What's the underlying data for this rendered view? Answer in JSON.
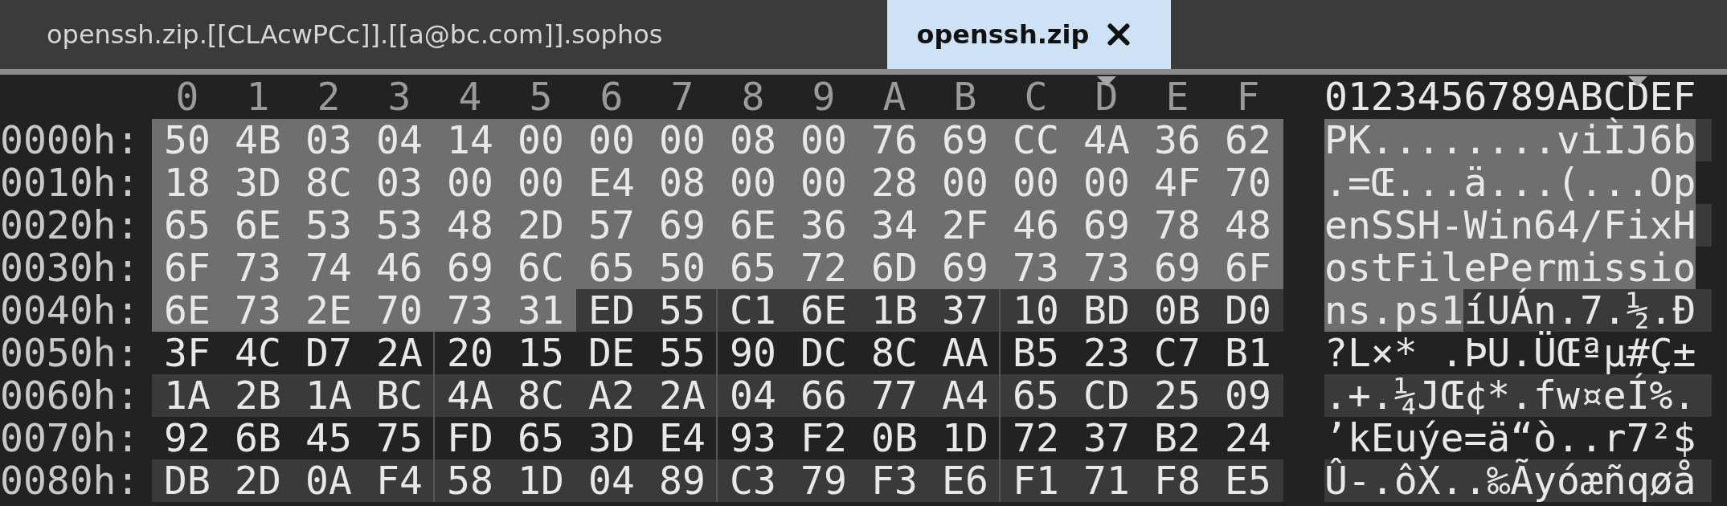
{
  "tabs": [
    {
      "label": "openssh.zip.[[CLAcwPCc]].[[a@bc.com]].sophos",
      "selected": false,
      "closable": false
    },
    {
      "label": "openssh.zip",
      "selected": true,
      "closable": true
    }
  ],
  "hex_view": {
    "columns": [
      {
        "label": "0",
        "marked": false
      },
      {
        "label": "1",
        "marked": false
      },
      {
        "label": "2",
        "marked": false
      },
      {
        "label": "3",
        "marked": false
      },
      {
        "label": "4",
        "marked": false
      },
      {
        "label": "5",
        "marked": false
      },
      {
        "label": "6",
        "marked": false
      },
      {
        "label": "7",
        "marked": false
      },
      {
        "label": "8",
        "marked": false
      },
      {
        "label": "9",
        "marked": false
      },
      {
        "label": "A",
        "marked": false
      },
      {
        "label": "B",
        "marked": false
      },
      {
        "label": "C",
        "marked": false
      },
      {
        "label": "D",
        "marked": true
      },
      {
        "label": "E",
        "marked": false
      },
      {
        "label": "F",
        "marked": false
      }
    ],
    "text_header": "0123456789ABCDEF",
    "rows": [
      {
        "offset": "0000h:",
        "selected_bytes": [
          "50",
          "4B",
          "03",
          "04",
          "14",
          "00",
          "00",
          "00",
          "08",
          "00",
          "76",
          "69",
          "CC",
          "4A",
          "36",
          "62"
        ],
        "bytes": [],
        "selected_text": "PK........viÌJ6b",
        "text": ""
      },
      {
        "offset": "0010h:",
        "selected_bytes": [
          "18",
          "3D",
          "8C",
          "03",
          "00",
          "00",
          "E4",
          "08",
          "00",
          "00",
          "28",
          "00",
          "00",
          "00",
          "4F",
          "70"
        ],
        "bytes": [],
        "selected_text": ".=Œ...ä...(...Op",
        "text": ""
      },
      {
        "offset": "0020h:",
        "selected_bytes": [
          "65",
          "6E",
          "53",
          "53",
          "48",
          "2D",
          "57",
          "69",
          "6E",
          "36",
          "34",
          "2F",
          "46",
          "69",
          "78",
          "48"
        ],
        "bytes": [],
        "selected_text": "enSSH-Win64/FixH",
        "text": ""
      },
      {
        "offset": "0030h:",
        "selected_bytes": [
          "6F",
          "73",
          "74",
          "46",
          "69",
          "6C",
          "65",
          "50",
          "65",
          "72",
          "6D",
          "69",
          "73",
          "73",
          "69",
          "6F"
        ],
        "bytes": [],
        "selected_text": "ostFilePermissio",
        "text": ""
      },
      {
        "offset": "0040h:",
        "selected_bytes": [
          "6E",
          "73",
          "2E",
          "70",
          "73",
          "31"
        ],
        "bytes": [
          "ED",
          "55",
          "C1",
          "6E",
          "1B",
          "37",
          "10",
          "BD",
          "0B",
          "D0"
        ],
        "selected_text": "ns.ps1",
        "text": "íUÁn.7.½.Ð"
      },
      {
        "offset": "0050h:",
        "selected_bytes": [],
        "bytes": [
          "3F",
          "4C",
          "D7",
          "2A",
          "20",
          "15",
          "DE",
          "55",
          "90",
          "DC",
          "8C",
          "AA",
          "B5",
          "23",
          "C7",
          "B1"
        ],
        "selected_text": "",
        "text": "?L×* .ÞU.ÜŒªµ#Ç±"
      },
      {
        "offset": "0060h:",
        "selected_bytes": [],
        "bytes": [
          "1A",
          "2B",
          "1A",
          "BC",
          "4A",
          "8C",
          "A2",
          "2A",
          "04",
          "66",
          "77",
          "A4",
          "65",
          "CD",
          "25",
          "09"
        ],
        "selected_text": "",
        "text": ".+.¼JŒ¢*.fw¤eÍ%."
      },
      {
        "offset": "0070h:",
        "selected_bytes": [],
        "bytes": [
          "92",
          "6B",
          "45",
          "75",
          "FD",
          "65",
          "3D",
          "E4",
          "93",
          "F2",
          "0B",
          "1D",
          "72",
          "37",
          "B2",
          "24"
        ],
        "selected_text": "",
        "text": "’kEuýe=ä“ò..r7²$"
      },
      {
        "offset": "0080h:",
        "selected_bytes": [],
        "bytes": [
          "DB",
          "2D",
          "0A",
          "F4",
          "58",
          "1D",
          "04",
          "89",
          "C3",
          "79",
          "F3",
          "E6",
          "F1",
          "71",
          "F8",
          "E5"
        ],
        "selected_text": "",
        "text": "Û-.ôX..‰Ãyóæñqøå"
      }
    ]
  }
}
